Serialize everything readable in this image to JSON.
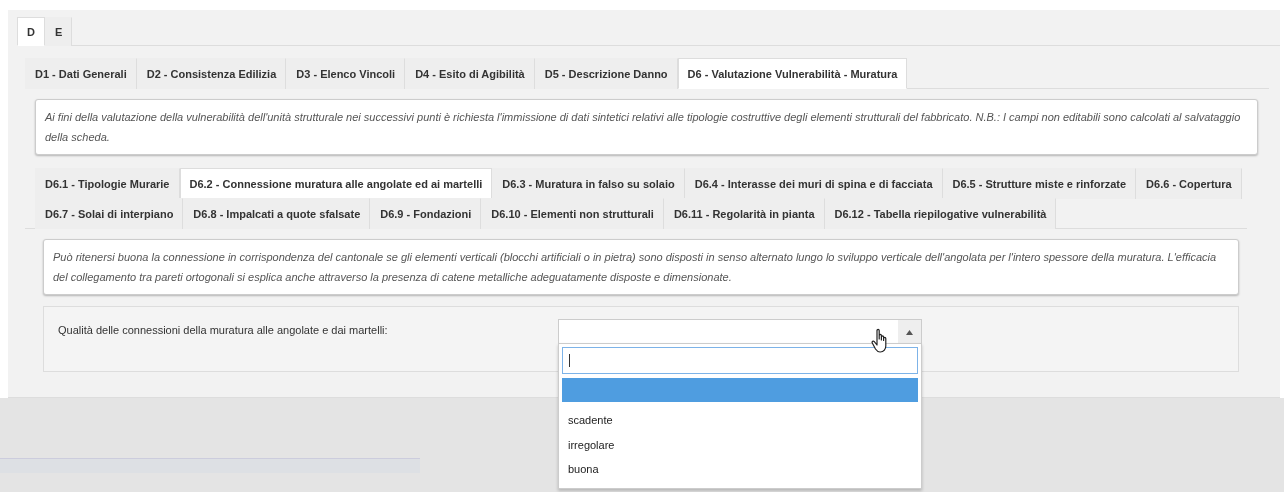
{
  "section_tabs": [
    {
      "label": "D",
      "selected": true
    },
    {
      "label": "E",
      "selected": false
    }
  ],
  "tabs": [
    {
      "label": "D1 - Dati Generali",
      "selected": false
    },
    {
      "label": "D2 - Consistenza Edilizia",
      "selected": false
    },
    {
      "label": "D3 - Elenco Vincoli",
      "selected": false
    },
    {
      "label": "D4 - Esito di Agibilità",
      "selected": false
    },
    {
      "label": "D5 - Descrizione Danno",
      "selected": false
    },
    {
      "label": "D6 - Valutazione Vulnerabilità - Muratura",
      "selected": true
    }
  ],
  "intro_note": "Ai fini della valutazione della vulnerabilità dell'unità strutturale nei successivi punti è richiesta l'immissione di dati sintetici relativi alle tipologie costruttive degli elementi strutturali del fabbricato. N.B.: I campi non editabili sono calcolati al salvataggio della scheda.",
  "subtab_rows": [
    {
      "tabs": [
        {
          "label": "D6.1 - Tipologie Murarie",
          "selected": false
        },
        {
          "label": "D6.2 - Connessione muratura alle angolate ed ai martelli",
          "selected": true
        },
        {
          "label": "D6.3 - Muratura in falso su solaio",
          "selected": false
        },
        {
          "label": "D6.4 - Interasse dei muri di spina e di facciata",
          "selected": false
        },
        {
          "label": "D6.5 - Strutture miste e rinforzate",
          "selected": false
        },
        {
          "label": "D6.6 - Copertura",
          "selected": false
        }
      ]
    },
    {
      "tabs": [
        {
          "label": "D6.7 - Solai di interpiano",
          "selected": false
        },
        {
          "label": "D6.8 - Impalcati a quote sfalsate",
          "selected": false
        },
        {
          "label": "D6.9 - Fondazioni",
          "selected": false
        },
        {
          "label": "D6.10 - Elementi non strutturali",
          "selected": false
        },
        {
          "label": "D6.11 - Regolarità in pianta",
          "selected": false
        },
        {
          "label": "D6.12 - Tabella riepilogative vulnerabilità",
          "selected": false
        }
      ]
    }
  ],
  "section_note": "Può ritenersi buona la connessione in corrispondenza del cantonale se gli elementi verticali (blocchi artificiali o in pietra) sono disposti in senso alternato lungo lo sviluppo verticale dell'angolata per l'intero spessore della muratura. L'efficacia del collegamento tra pareti ortogonali si esplica anche attraverso la presenza di catene metalliche adeguatamente disposte e dimensionate.",
  "field": {
    "label": "Qualità delle connessioni della muratura alle angolate e dai martelli:",
    "expanded": true,
    "blank_option_highlighted": true,
    "options": [
      {
        "label": "scadente"
      },
      {
        "label": "irregolare"
      },
      {
        "label": "buona"
      }
    ]
  }
}
